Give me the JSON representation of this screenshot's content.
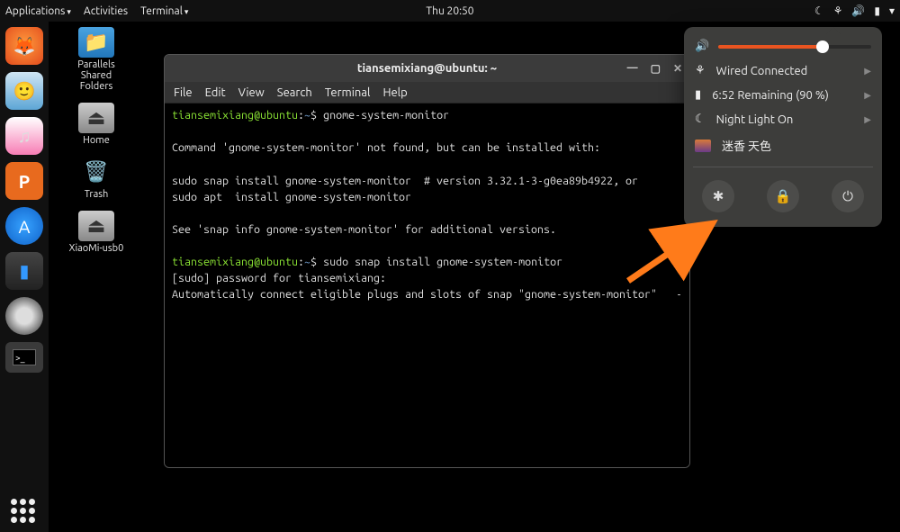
{
  "topbar": {
    "applications": "Applications",
    "activities": "Activities",
    "terminal": "Terminal",
    "clock": "Thu 20:50"
  },
  "desktop": {
    "parallels": "Parallels Shared Folders",
    "home": "Home",
    "trash": "Trash",
    "xiaomi": "XiaoMi-usb0"
  },
  "window": {
    "title": "tiansemixiang@ubuntu: ~",
    "menu": {
      "file": "File",
      "edit": "Edit",
      "view": "View",
      "search": "Search",
      "terminal": "Terminal",
      "help": "Help"
    },
    "term": {
      "prompt_user": "tiansemixiang@ubuntu",
      "tilde": "~",
      "cmd1": "gnome-system-monitor",
      "l1": "Command 'gnome-system-monitor' not found, but can be installed with:",
      "l2": "sudo snap install gnome-system-monitor  # version 3.32.1-3-g0ea89b4922, or",
      "l3": "sudo apt  install gnome-system-monitor",
      "l4": "See 'snap info gnome-system-monitor' for additional versions.",
      "cmd2": "sudo snap install gnome-system-monitor",
      "l5": "[sudo] password for tiansemixiang:",
      "l6": "Automatically connect eligible plugs and slots of snap \"gnome-system-monitor\"   -"
    }
  },
  "popover": {
    "wired": "Wired Connected",
    "battery": "6:52 Remaining (90 %)",
    "nightlight": "Night Light On",
    "background": "迷香 天色"
  }
}
